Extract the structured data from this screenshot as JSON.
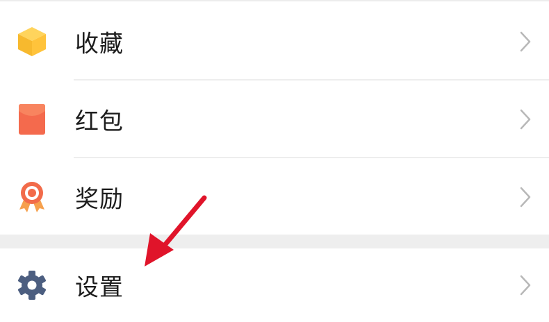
{
  "menu": {
    "items": [
      {
        "id": "favorites",
        "label": "收藏",
        "icon": "favorites-cube-icon"
      },
      {
        "id": "red-packet",
        "label": "红包",
        "icon": "red-packet-icon"
      },
      {
        "id": "rewards",
        "label": "奖励",
        "icon": "award-medal-icon"
      },
      {
        "id": "settings",
        "label": "设置",
        "icon": "gear-icon"
      }
    ],
    "chevron_icon": "chevron-right-icon"
  },
  "colors": {
    "favorites": "#FFC33B",
    "red_packet": "#F46A4D",
    "award": "#F26B4A",
    "settings": "#4C5E80",
    "chevron": "#B8B8B8",
    "annotation": "#E0142A"
  }
}
